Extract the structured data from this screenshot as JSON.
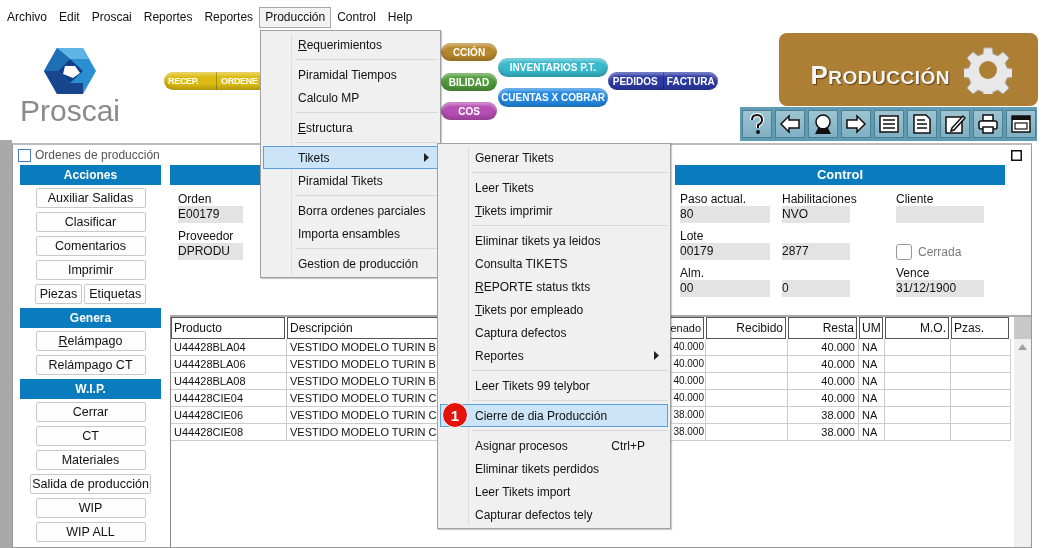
{
  "menu_bar": [
    {
      "label": "Archivo",
      "selected": false
    },
    {
      "label": "Edit",
      "selected": false
    },
    {
      "label": "Proscai",
      "selected": false
    },
    {
      "label": "Reportes",
      "selected": false
    },
    {
      "label": "Reportes",
      "selected": false
    },
    {
      "label": "Producción",
      "selected": true
    },
    {
      "label": "Control",
      "selected": false
    },
    {
      "label": "Help",
      "selected": false
    }
  ],
  "header": {
    "logo_text": "Proscai",
    "pills": [
      {
        "labels": [
          "RECEP.",
          "ORDENE"
        ],
        "color": "#dcbc12"
      },
      {
        "labels": [
          "CCIÓN"
        ],
        "color": "#b8882c"
      },
      {
        "labels": [
          "BILIDAD"
        ],
        "color": "#4f9a3a"
      },
      {
        "labels": [
          "COS"
        ],
        "color": "#b64fb3"
      },
      {
        "labels": [
          "INVENTARIOS P.T."
        ],
        "color": "#37b8cc"
      },
      {
        "labels": [
          "CUENTAS X COBRAR"
        ],
        "color": "#2388e0"
      },
      {
        "labels": [
          "PEDIDOS",
          "FACTURA"
        ],
        "color": "#2c3aa4"
      }
    ],
    "banner": "PRODUCCIÓN"
  },
  "window": {
    "title": "Ordenes de producción",
    "sidebar": [
      {
        "title": "Acciones",
        "rows": [
          [
            {
              "label": "Auxiliar Salidas",
              "mnemonic": false
            }
          ],
          [
            {
              "label": "Clasificar",
              "mnemonic": false
            }
          ],
          [
            {
              "label": "Comentarios",
              "mnemonic": false
            }
          ],
          [
            {
              "label": "Imprimir",
              "mnemonic": false
            }
          ],
          [
            {
              "label": "Piezas",
              "mnemonic": false
            },
            {
              "label": "Etiquetas",
              "mnemonic": false
            }
          ]
        ]
      },
      {
        "title": "Genera",
        "rows": [
          [
            {
              "label": "Relámpago",
              "mnemonic": true
            }
          ],
          [
            {
              "label": "Relámpago CT",
              "mnemonic": false
            }
          ]
        ]
      },
      {
        "title": "W.I.P.",
        "rows": [
          [
            {
              "label": "Cerrar",
              "mnemonic": false
            }
          ],
          [
            {
              "label": "CT",
              "mnemonic": false
            }
          ],
          [
            {
              "label": "Materiales",
              "mnemonic": false
            }
          ],
          [
            {
              "label": "Salida de producción",
              "mnemonic": false
            }
          ],
          [
            {
              "label": "WIP",
              "mnemonic": false
            }
          ],
          [
            {
              "label": "WIP ALL",
              "mnemonic": false
            }
          ]
        ]
      }
    ],
    "control_header": "Control",
    "left_fields": [
      [
        {
          "label": "Orden",
          "value": "E00179"
        }
      ],
      [
        {
          "label": "Proveedor",
          "value": "DPRODU"
        }
      ]
    ],
    "right_fields": [
      [
        {
          "kind": "field",
          "label": "Paso actual.",
          "value": "80"
        },
        {
          "kind": "field",
          "label": "Habilitaciones",
          "value": "NVO"
        },
        {
          "kind": "field",
          "label": "Cliente"
        }
      ],
      [
        {
          "kind": "field",
          "label": "Lote",
          "value": "00179"
        },
        {
          "kind": "field",
          "value": "2877"
        },
        {
          "kind": "checkbox",
          "label": "Cerrada",
          "checked": false,
          "disabled": true
        }
      ],
      [
        {
          "kind": "field",
          "label": "Alm.",
          "value": "00"
        },
        {
          "kind": "field",
          "value": "0"
        },
        {
          "kind": "field",
          "label": "Vence",
          "value": "31/12/1900"
        }
      ]
    ],
    "table": {
      "columns": [
        "Producto",
        "Descripción",
        "enado",
        "Recibido",
        "Resta",
        "UM",
        "M.O.",
        "Pzas."
      ],
      "rows": [
        [
          "U44428BLA04",
          "VESTIDO MODELO TURIN B",
          "40.000",
          null,
          "40.000",
          "NA",
          null,
          null
        ],
        [
          "U44428BLA06",
          "VESTIDO MODELO TURIN B",
          "40.000",
          null,
          "40.000",
          "NA",
          null,
          null
        ],
        [
          "U44428BLA08",
          "VESTIDO MODELO TURIN B",
          "40.000",
          null,
          "40.000",
          "NA",
          null,
          null
        ],
        [
          "U44428CIE04",
          "VESTIDO MODELO TURIN C",
          "40.000",
          null,
          "40.000",
          "NA",
          null,
          null
        ],
        [
          "U44428CIE06",
          "VESTIDO MODELO TURIN C",
          "38.000",
          null,
          "38.000",
          "NA",
          null,
          null
        ],
        [
          "U44428CIE08",
          "VESTIDO MODELO TURIN C",
          "38.000",
          null,
          "38.000",
          "NA",
          null,
          null
        ]
      ]
    }
  },
  "produccion_menu": [
    {
      "kind": "item",
      "label": "Requerimientos",
      "mnemonic": true,
      "selected": false
    },
    {
      "kind": "separator"
    },
    {
      "kind": "item",
      "label": "Piramidal Tiempos",
      "mnemonic": false,
      "selected": false
    },
    {
      "kind": "item",
      "label": "Calculo MP",
      "mnemonic": false,
      "selected": false
    },
    {
      "kind": "separator"
    },
    {
      "kind": "item",
      "label": "Estructura",
      "mnemonic": true,
      "selected": false
    },
    {
      "kind": "separator"
    },
    {
      "kind": "item",
      "label": "Tikets",
      "mnemonic": false,
      "selected": true,
      "submenu": true
    },
    {
      "kind": "item",
      "label": "Piramidal Tikets",
      "mnemonic": false,
      "selected": false
    },
    {
      "kind": "separator"
    },
    {
      "kind": "item",
      "label": "Borra ordenes parciales",
      "mnemonic": false,
      "selected": false
    },
    {
      "kind": "item",
      "label": "Importa ensambles",
      "mnemonic": false,
      "selected": false
    },
    {
      "kind": "separator"
    },
    {
      "kind": "item",
      "label": "Gestion de producción",
      "mnemonic": false,
      "selected": false
    }
  ],
  "tikets_menu": [
    {
      "kind": "item",
      "label": "Generar Tikets",
      "mnemonic": false,
      "selected": false
    },
    {
      "kind": "separator"
    },
    {
      "kind": "item",
      "label": "Leer Tikets",
      "mnemonic": false,
      "selected": false
    },
    {
      "kind": "item",
      "label": "Tikets imprimir",
      "mnemonic": true,
      "selected": false
    },
    {
      "kind": "separator"
    },
    {
      "kind": "item",
      "label": "Eliminar tikets ya leidos",
      "mnemonic": false,
      "selected": false
    },
    {
      "kind": "item",
      "label": "Consulta TIKETS",
      "mnemonic": false,
      "selected": false
    },
    {
      "kind": "item",
      "label": "REPORTE status tkts",
      "mnemonic": true,
      "selected": false
    },
    {
      "kind": "item",
      "label": "Tikets por empleado",
      "mnemonic": true,
      "selected": false
    },
    {
      "kind": "item",
      "label": "Captura defectos",
      "mnemonic": false,
      "selected": false
    },
    {
      "kind": "item",
      "label": "Reportes",
      "mnemonic": false,
      "selected": false,
      "submenu": true
    },
    {
      "kind": "separator"
    },
    {
      "kind": "item",
      "label": "Leer Tikets 99 telybor",
      "mnemonic": false,
      "selected": false
    },
    {
      "kind": "separator"
    },
    {
      "kind": "item",
      "label": "Cierre de dia Producción",
      "mnemonic": false,
      "selected": true,
      "badge": "1"
    },
    {
      "kind": "separator"
    },
    {
      "kind": "item",
      "label": "Asignar procesos",
      "mnemonic": false,
      "selected": false,
      "shortcut": "Ctrl+P"
    },
    {
      "kind": "item",
      "label": "Eliminar tikets perdidos",
      "mnemonic": false,
      "selected": false
    },
    {
      "kind": "item",
      "label": "Leer Tikets import",
      "mnemonic": false,
      "selected": false
    },
    {
      "kind": "item",
      "label": "Capturar defectos tely",
      "mnemonic": false,
      "selected": false
    }
  ]
}
